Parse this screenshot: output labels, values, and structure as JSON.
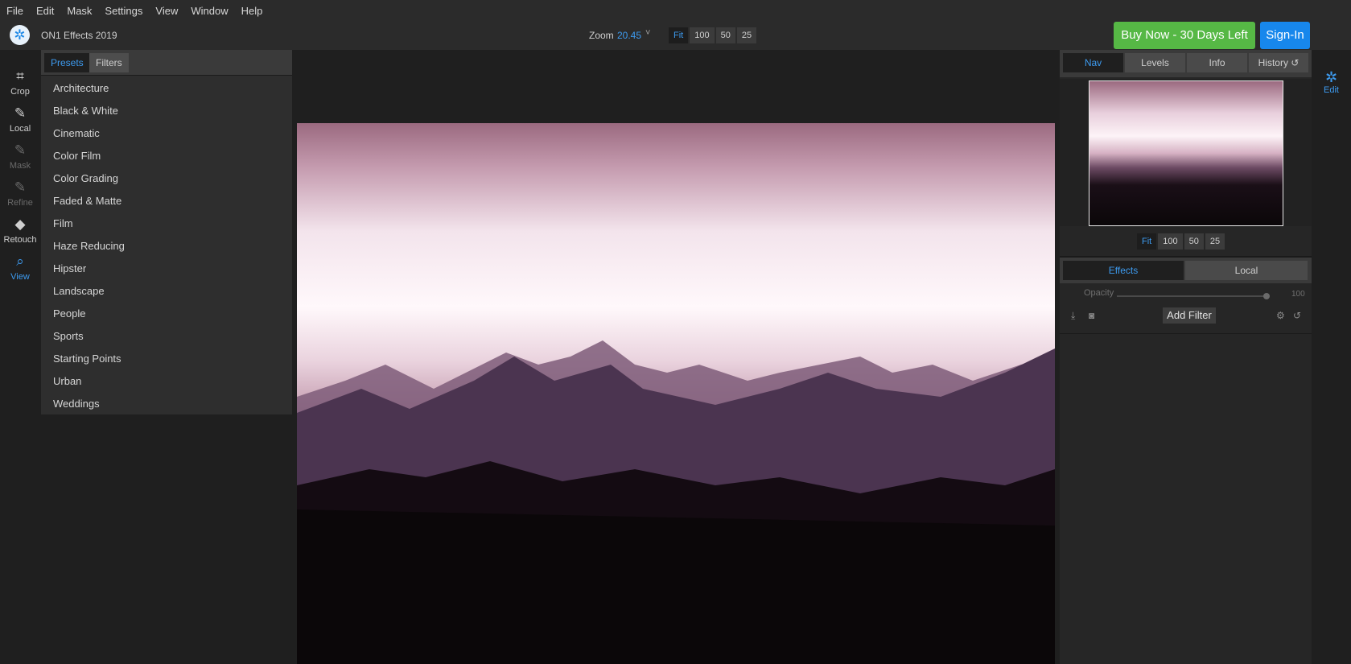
{
  "menu": {
    "items": [
      {
        "label": "File"
      },
      {
        "label": "Edit"
      },
      {
        "label": "Mask"
      },
      {
        "label": "Settings"
      },
      {
        "label": "View"
      },
      {
        "label": "Window"
      },
      {
        "label": "Help"
      }
    ]
  },
  "app": {
    "title": "ON1 Effects 2019",
    "logo_icon": "on1-logo-icon"
  },
  "zoom": {
    "label": "Zoom",
    "value": "20.45",
    "caret": "˅",
    "buttons": [
      "Fit",
      "100",
      "50",
      "25"
    ],
    "active": "Fit"
  },
  "header_actions": {
    "buy_label": "Buy Now - 30 Days Left",
    "signin_label": "Sign-In",
    "buy_color": "#56b845",
    "signin_color": "#1787ec"
  },
  "left_tools": [
    {
      "label": "Crop",
      "icon": "crop-icon",
      "glyph": "⌗",
      "state": "normal"
    },
    {
      "label": "Local",
      "icon": "brush-icon",
      "glyph": "✎",
      "state": "normal"
    },
    {
      "label": "Mask",
      "icon": "mask-brush-icon",
      "glyph": "✎",
      "state": "dim"
    },
    {
      "label": "Refine",
      "icon": "refine-brush-icon",
      "glyph": "✎",
      "state": "dim"
    },
    {
      "label": "Retouch",
      "icon": "eraser-icon",
      "glyph": "◆",
      "state": "normal"
    },
    {
      "label": "View",
      "icon": "zoom-hand-icon",
      "glyph": "⌕",
      "state": "active"
    }
  ],
  "presets_panel": {
    "tabs": [
      {
        "label": "Presets",
        "active": true
      },
      {
        "label": "Filters",
        "active": false
      }
    ],
    "categories": [
      "Architecture",
      "Black & White",
      "Cinematic",
      "Color Film",
      "Color Grading",
      "Faded & Matte",
      "Film",
      "Haze Reducing",
      "Hipster",
      "Landscape",
      "People",
      "Sports",
      "Starting Points",
      "Urban",
      "Weddings"
    ]
  },
  "right_panel": {
    "tabs": [
      {
        "label": "Nav",
        "active": true
      },
      {
        "label": "Levels",
        "active": false
      },
      {
        "label": "Info",
        "active": false
      },
      {
        "label": "History",
        "active": false
      }
    ],
    "history_icon": "undo-icon",
    "nav_zoom_buttons": [
      "Fit",
      "100",
      "50",
      "25"
    ],
    "nav_zoom_active": "Fit",
    "sub_tabs": [
      {
        "label": "Effects",
        "active": true
      },
      {
        "label": "Local",
        "active": false
      }
    ],
    "opacity": {
      "label": "Opacity",
      "value": "100",
      "fraction": 1.0
    },
    "add_filter_label": "Add Filter",
    "left_icons": [
      "import-layer-icon",
      "mask-thumbnail-icon"
    ],
    "right_icons": [
      "settings-gear-icon",
      "reset-icon"
    ]
  },
  "module_switch": {
    "label": "Edit",
    "icon": "edit-module-icon",
    "accent": "#3d9bf0"
  }
}
